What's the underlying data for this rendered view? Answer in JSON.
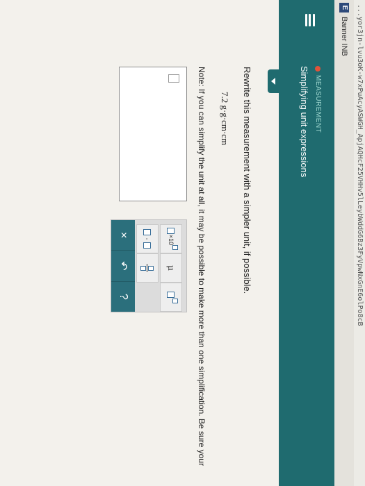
{
  "browser": {
    "url_fragment": "...yor3jn-lvu3oK-w7xPuAcyASWGH_ApjAQHcF25VHHv5lLeybWddG6Bz3FyVpwNxGnE6olPo8cB",
    "bookmark_icon": "E",
    "bookmark_label": "Banner INB"
  },
  "header": {
    "category": "MEASUREMENT",
    "topic": "Simplifying unit expressions"
  },
  "question": {
    "instruction": "Rewrite this measurement with a simpler unit, if possible.",
    "expression": "7.2 g·g·cm·cm",
    "note": "Note: If you can simplify the unit at all, it may be possible to make more than one simplification. Be sure your"
  },
  "toolbar": {
    "sci_label": "×10",
    "mu_label": "μ",
    "dot_label": "·",
    "clear_label": "×",
    "undo_label": "↶",
    "help_label": "?"
  },
  "colors": {
    "header_bg": "#1f6b6f",
    "action_bar": "#2b6f7c",
    "category_dot": "#e0533a"
  }
}
